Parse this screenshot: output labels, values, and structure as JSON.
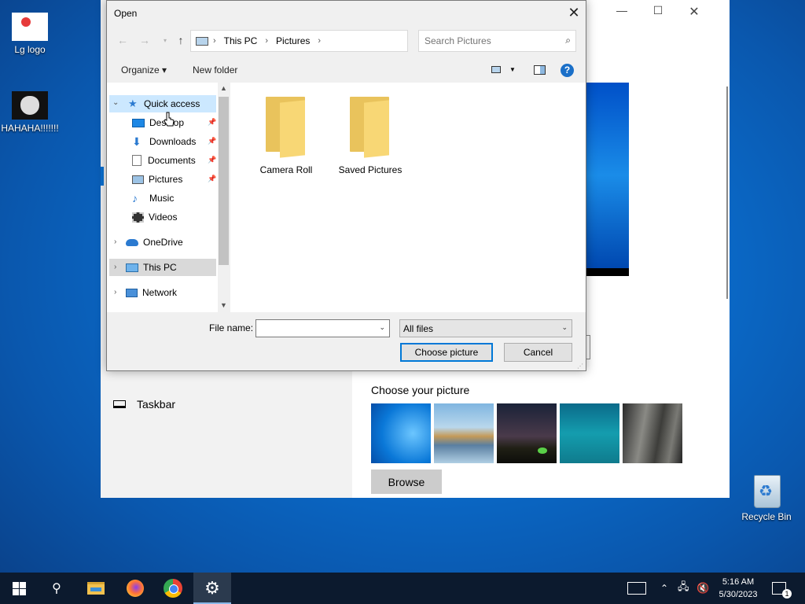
{
  "desktop": {
    "icons": [
      {
        "label": "Lg logo"
      },
      {
        "label": "HAHAHA!!!!!!!"
      },
      {
        "label": "Recycle Bin"
      }
    ]
  },
  "settings_window": {
    "minimize": "—",
    "maximize": "☐",
    "close": "✕",
    "nav_taskbar": "Taskbar",
    "choose_picture_title": "Choose your picture",
    "browse_label": "Browse"
  },
  "dialog": {
    "title": "Open",
    "close": "✕",
    "nav": {
      "back": "←",
      "forward": "→",
      "recent": "▾",
      "up": "↑"
    },
    "address": {
      "segments": [
        "This PC",
        "Pictures"
      ],
      "separator": "›",
      "dropdown": "⌄",
      "refresh": "↻"
    },
    "search_placeholder": "Search Pictures",
    "search_icon": "⌕",
    "toolbar": {
      "organize": "Organize ▾",
      "new_folder": "New folder",
      "view_dropdown": "▼",
      "help": "?"
    },
    "nav_pane": {
      "quick_access": "Quick access",
      "items": [
        {
          "label": "Desktop",
          "pinned": true
        },
        {
          "label": "Downloads",
          "pinned": true
        },
        {
          "label": "Documents",
          "pinned": true
        },
        {
          "label": "Pictures",
          "pinned": true
        },
        {
          "label": "Music",
          "pinned": false
        },
        {
          "label": "Videos",
          "pinned": false
        }
      ],
      "onedrive": "OneDrive",
      "this_pc": "This PC",
      "network": "Network",
      "expand_open": "⌄",
      "expand_closed": "›",
      "pin": "📌",
      "scroll_up": "▲",
      "scroll_down": "▼"
    },
    "folders": [
      {
        "label": "Camera Roll"
      },
      {
        "label": "Saved Pictures"
      }
    ],
    "file_name_label": "File name:",
    "file_name_value": "",
    "file_type_value": "All files",
    "dropdown_glyph": "⌄",
    "choose_button": "Choose picture",
    "cancel_button": "Cancel",
    "grip": "⋰"
  },
  "taskbar": {
    "search_icon": "⚲",
    "settings_icon": "⚙",
    "tray_chevron": "⌃",
    "network_icon": "🖧",
    "volume_icon": "🔇",
    "time": "5:16 AM",
    "date": "5/30/2023",
    "notification_count": "1"
  }
}
